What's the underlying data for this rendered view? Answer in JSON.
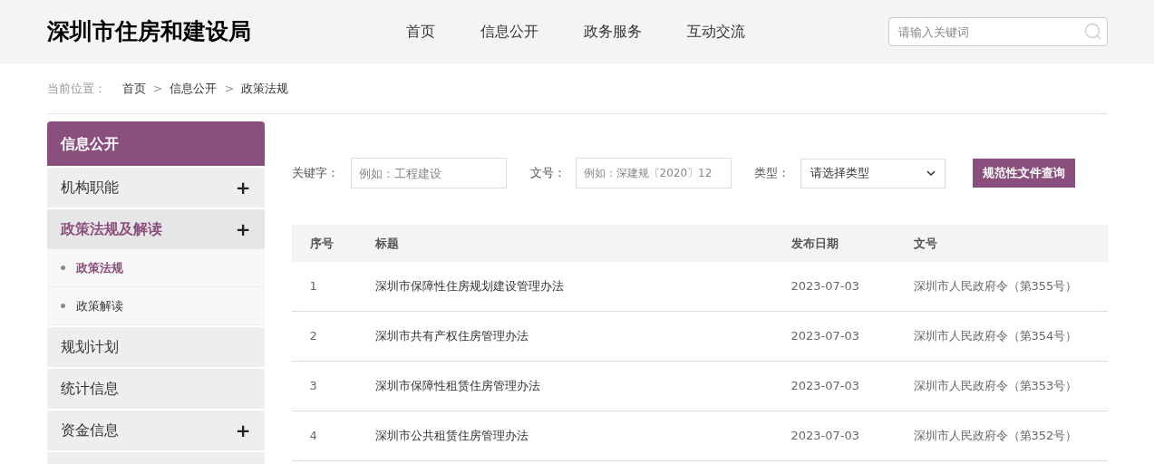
{
  "header": {
    "site_title": "深圳市住房和建设局",
    "nav": [
      {
        "label": "首页",
        "selected": false
      },
      {
        "label": "信息公开",
        "selected": false
      },
      {
        "label": "政务服务",
        "selected": false
      },
      {
        "label": "互动交流",
        "selected": false
      }
    ],
    "search": {
      "placeholder": "请输入关键词"
    }
  },
  "breadcrumb": {
    "label": "当前位置：",
    "items": [
      "首页",
      "信息公开",
      "政策法规"
    ],
    "separator": ">"
  },
  "sidebar": {
    "title": "信息公开",
    "items": [
      {
        "label": "机构职能",
        "selected": false,
        "toggle": "+"
      },
      {
        "label": "政策法规及解读",
        "selected": true,
        "toggle": "+",
        "children": [
          {
            "label": "政策法规",
            "selected": true
          },
          {
            "label": "政策解读",
            "selected": false
          }
        ]
      },
      {
        "label": "规划计划",
        "selected": false
      },
      {
        "label": "统计信息",
        "selected": false
      },
      {
        "label": "资金信息",
        "selected": false,
        "toggle": "+"
      }
    ]
  },
  "filters": {
    "keyword": {
      "label": "关键字：",
      "placeholder": "例如：工程建设"
    },
    "doc_number": {
      "label": "文号：",
      "placeholder": "例如：深建规〔2020〕12"
    },
    "type": {
      "label": "类型：",
      "value": "请选择类型"
    },
    "submit": "规范性文件查询"
  },
  "table": {
    "columns": [
      "序号",
      "标题",
      "发布日期",
      "文号"
    ],
    "rows": [
      [
        "1",
        "深圳市保障性住房规划建设管理办法",
        "2023-07-03",
        "深圳市人民政府令（第355号）"
      ],
      [
        "2",
        "深圳市共有产权住房管理办法",
        "2023-07-03",
        "深圳市人民政府令（第354号）"
      ],
      [
        "3",
        "深圳市保障性租赁住房管理办法",
        "2023-07-03",
        "深圳市人民政府令（第353号）"
      ],
      [
        "4",
        "深圳市公共租赁住房管理办法",
        "2023-07-03",
        "深圳市人民政府令（第352号）"
      ]
    ]
  }
}
